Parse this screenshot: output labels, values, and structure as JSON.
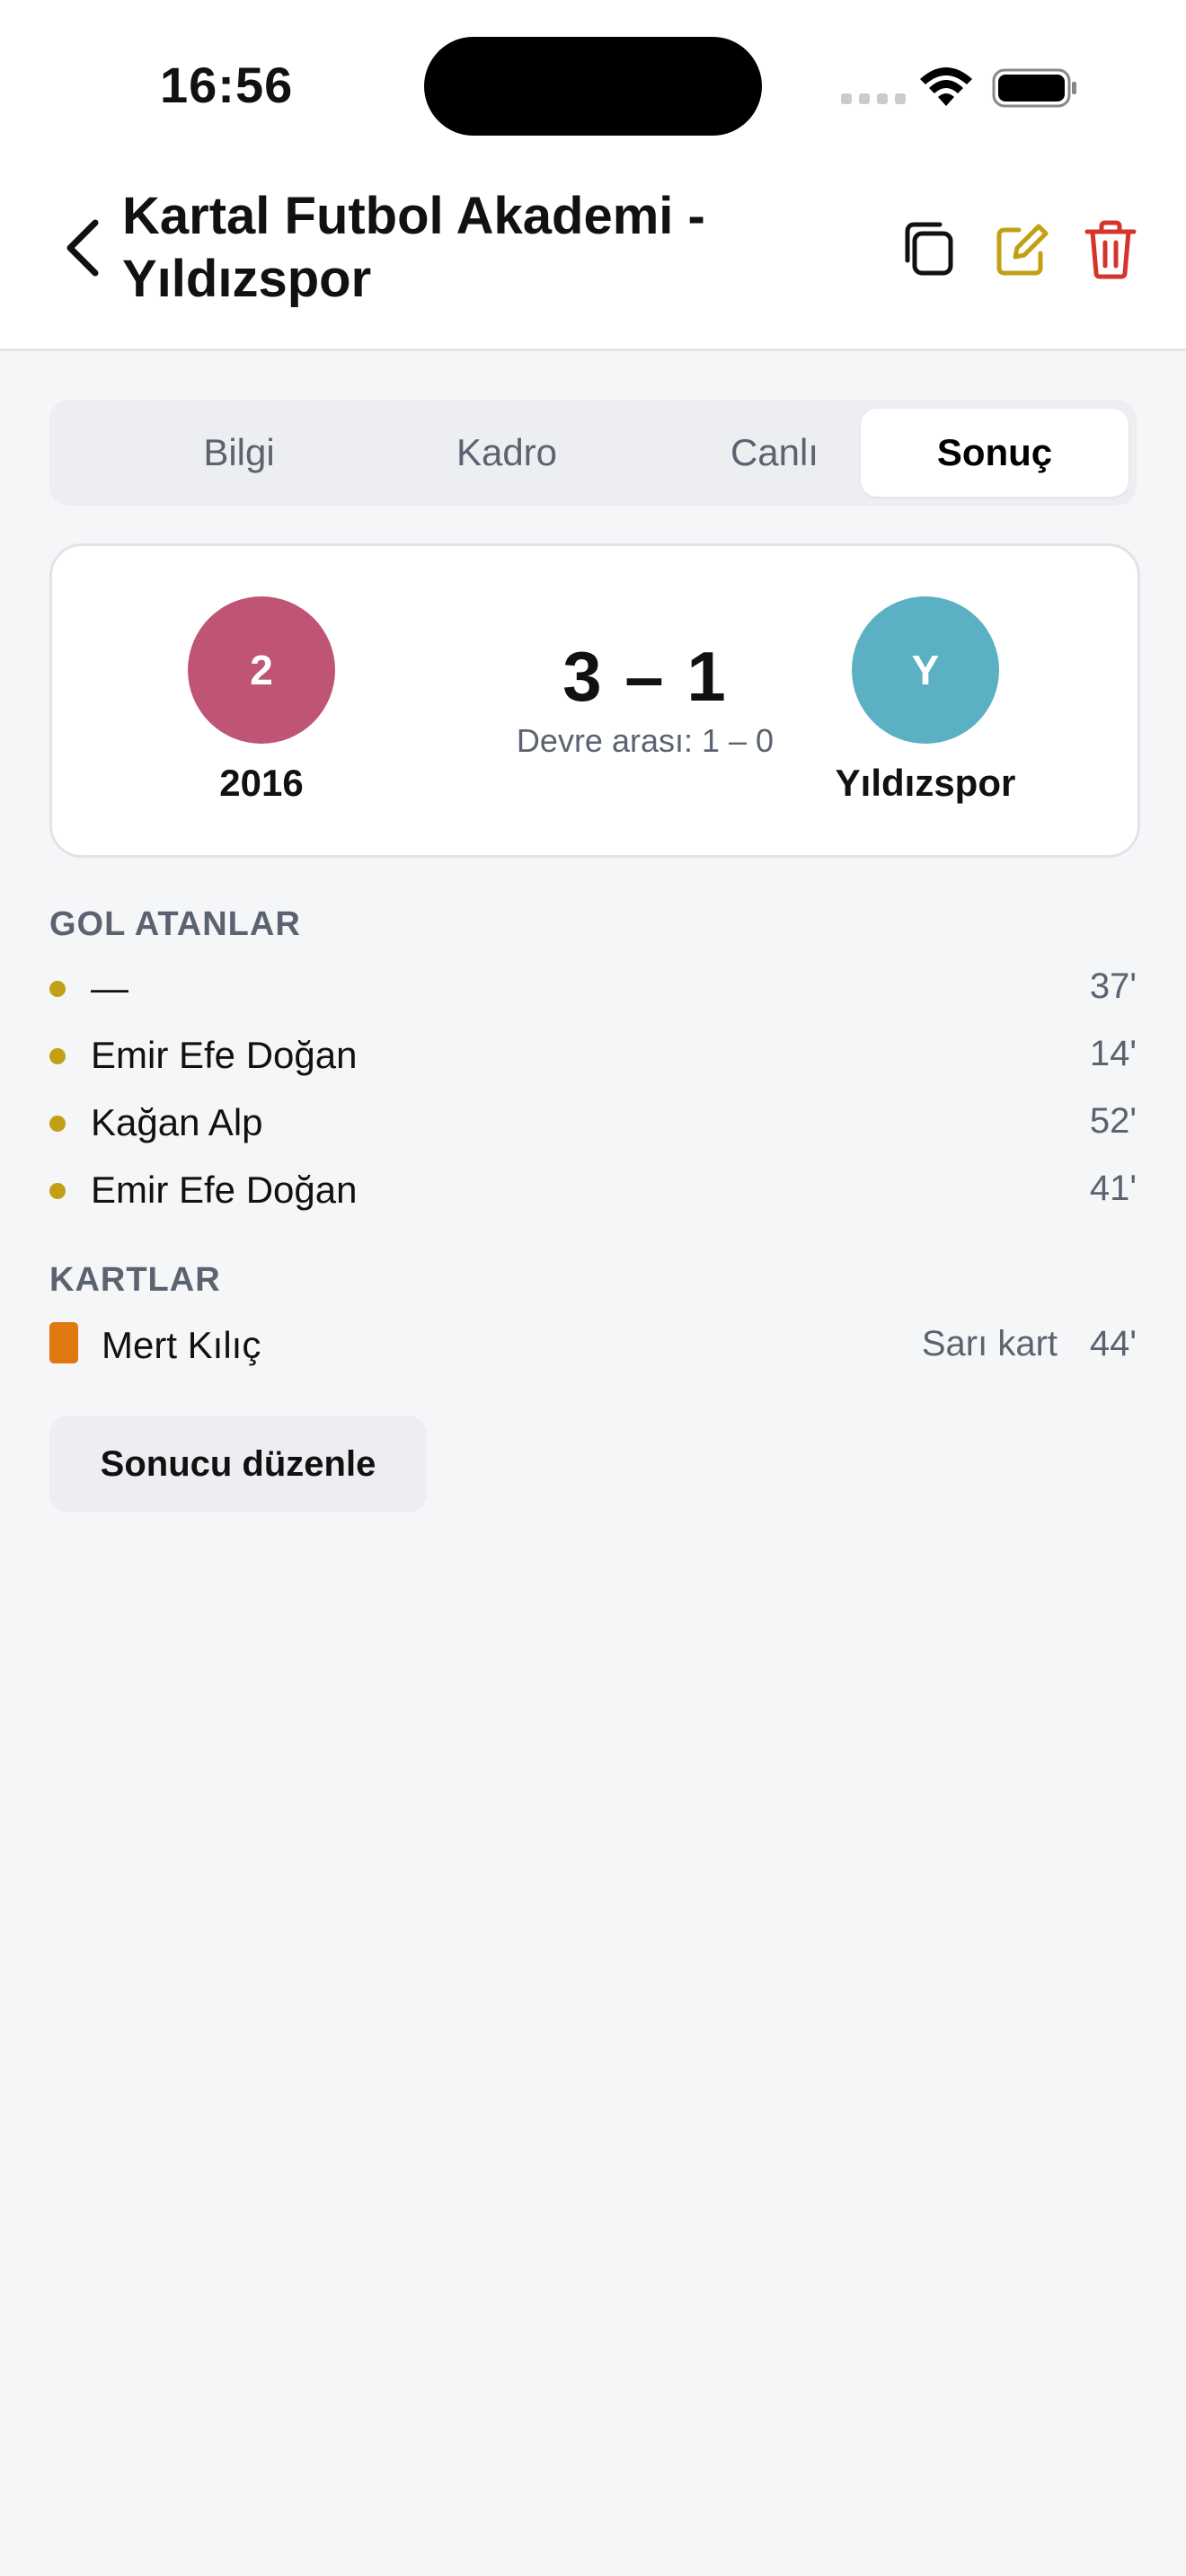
{
  "status": {
    "time": "16:56"
  },
  "header": {
    "title": "Kartal Futbol Akademi - Yıldızspor"
  },
  "icons": {
    "back": "chevron-left-icon",
    "copy": "copy-icon",
    "edit": "edit-icon",
    "delete": "trash-icon"
  },
  "colors": {
    "accent": "#c2a016",
    "danger": "#d6342b",
    "home_avatar": "#c05475",
    "away_avatar": "#5bb0c4",
    "card": "#e0780f"
  },
  "tabs": [
    {
      "label": "Bilgi"
    },
    {
      "label": "Kadro"
    },
    {
      "label": "Canlı"
    },
    {
      "label": "Sonuç",
      "active": true
    }
  ],
  "match": {
    "home": {
      "initial": "2",
      "name": "2016"
    },
    "away": {
      "initial": "Y",
      "name": "Yıldızspor"
    },
    "score": "3 – 1",
    "halftime": "Devre arası: 1 – 0"
  },
  "goals": {
    "title": "GOL ATANLAR",
    "items": [
      {
        "name": "—",
        "minute": "37'"
      },
      {
        "name": "Emir Efe Doğan",
        "minute": "14'"
      },
      {
        "name": "Kağan Alp",
        "minute": "52'"
      },
      {
        "name": "Emir Efe Doğan",
        "minute": "41'"
      }
    ]
  },
  "cards": {
    "title": "KARTLAR",
    "items": [
      {
        "name": "Mert Kılıç",
        "type": "Sarı kart",
        "minute": "44'"
      }
    ]
  },
  "actions": {
    "edit_result": "Sonucu düzenle"
  }
}
